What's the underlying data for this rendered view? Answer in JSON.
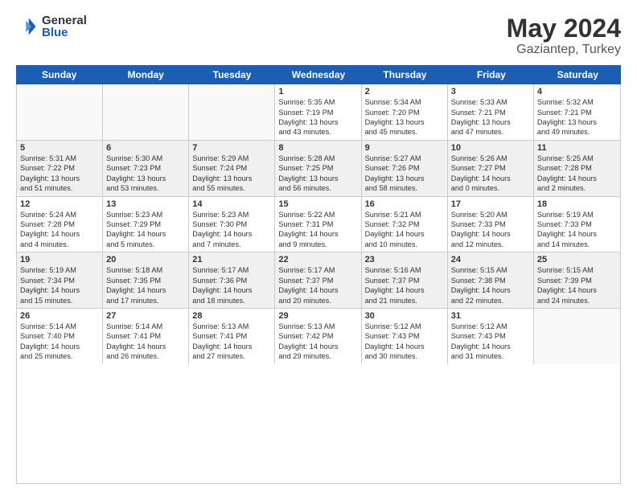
{
  "logo": {
    "general": "General",
    "blue": "Blue"
  },
  "title": "May 2024",
  "location": "Gaziantep, Turkey",
  "days": [
    "Sunday",
    "Monday",
    "Tuesday",
    "Wednesday",
    "Thursday",
    "Friday",
    "Saturday"
  ],
  "weeks": [
    [
      {
        "day": "",
        "info": ""
      },
      {
        "day": "",
        "info": ""
      },
      {
        "day": "",
        "info": ""
      },
      {
        "day": "1",
        "info": "Sunrise: 5:35 AM\nSunset: 7:19 PM\nDaylight: 13 hours\nand 43 minutes."
      },
      {
        "day": "2",
        "info": "Sunrise: 5:34 AM\nSunset: 7:20 PM\nDaylight: 13 hours\nand 45 minutes."
      },
      {
        "day": "3",
        "info": "Sunrise: 5:33 AM\nSunset: 7:21 PM\nDaylight: 13 hours\nand 47 minutes."
      },
      {
        "day": "4",
        "info": "Sunrise: 5:32 AM\nSunset: 7:21 PM\nDaylight: 13 hours\nand 49 minutes."
      }
    ],
    [
      {
        "day": "5",
        "info": "Sunrise: 5:31 AM\nSunset: 7:22 PM\nDaylight: 13 hours\nand 51 minutes."
      },
      {
        "day": "6",
        "info": "Sunrise: 5:30 AM\nSunset: 7:23 PM\nDaylight: 13 hours\nand 53 minutes."
      },
      {
        "day": "7",
        "info": "Sunrise: 5:29 AM\nSunset: 7:24 PM\nDaylight: 13 hours\nand 55 minutes."
      },
      {
        "day": "8",
        "info": "Sunrise: 5:28 AM\nSunset: 7:25 PM\nDaylight: 13 hours\nand 56 minutes."
      },
      {
        "day": "9",
        "info": "Sunrise: 5:27 AM\nSunset: 7:26 PM\nDaylight: 13 hours\nand 58 minutes."
      },
      {
        "day": "10",
        "info": "Sunrise: 5:26 AM\nSunset: 7:27 PM\nDaylight: 14 hours\nand 0 minutes."
      },
      {
        "day": "11",
        "info": "Sunrise: 5:25 AM\nSunset: 7:28 PM\nDaylight: 14 hours\nand 2 minutes."
      }
    ],
    [
      {
        "day": "12",
        "info": "Sunrise: 5:24 AM\nSunset: 7:28 PM\nDaylight: 14 hours\nand 4 minutes."
      },
      {
        "day": "13",
        "info": "Sunrise: 5:23 AM\nSunset: 7:29 PM\nDaylight: 14 hours\nand 5 minutes."
      },
      {
        "day": "14",
        "info": "Sunrise: 5:23 AM\nSunset: 7:30 PM\nDaylight: 14 hours\nand 7 minutes."
      },
      {
        "day": "15",
        "info": "Sunrise: 5:22 AM\nSunset: 7:31 PM\nDaylight: 14 hours\nand 9 minutes."
      },
      {
        "day": "16",
        "info": "Sunrise: 5:21 AM\nSunset: 7:32 PM\nDaylight: 14 hours\nand 10 minutes."
      },
      {
        "day": "17",
        "info": "Sunrise: 5:20 AM\nSunset: 7:33 PM\nDaylight: 14 hours\nand 12 minutes."
      },
      {
        "day": "18",
        "info": "Sunrise: 5:19 AM\nSunset: 7:33 PM\nDaylight: 14 hours\nand 14 minutes."
      }
    ],
    [
      {
        "day": "19",
        "info": "Sunrise: 5:19 AM\nSunset: 7:34 PM\nDaylight: 14 hours\nand 15 minutes."
      },
      {
        "day": "20",
        "info": "Sunrise: 5:18 AM\nSunset: 7:35 PM\nDaylight: 14 hours\nand 17 minutes."
      },
      {
        "day": "21",
        "info": "Sunrise: 5:17 AM\nSunset: 7:36 PM\nDaylight: 14 hours\nand 18 minutes."
      },
      {
        "day": "22",
        "info": "Sunrise: 5:17 AM\nSunset: 7:37 PM\nDaylight: 14 hours\nand 20 minutes."
      },
      {
        "day": "23",
        "info": "Sunrise: 5:16 AM\nSunset: 7:37 PM\nDaylight: 14 hours\nand 21 minutes."
      },
      {
        "day": "24",
        "info": "Sunrise: 5:15 AM\nSunset: 7:38 PM\nDaylight: 14 hours\nand 22 minutes."
      },
      {
        "day": "25",
        "info": "Sunrise: 5:15 AM\nSunset: 7:39 PM\nDaylight: 14 hours\nand 24 minutes."
      }
    ],
    [
      {
        "day": "26",
        "info": "Sunrise: 5:14 AM\nSunset: 7:40 PM\nDaylight: 14 hours\nand 25 minutes."
      },
      {
        "day": "27",
        "info": "Sunrise: 5:14 AM\nSunset: 7:41 PM\nDaylight: 14 hours\nand 26 minutes."
      },
      {
        "day": "28",
        "info": "Sunrise: 5:13 AM\nSunset: 7:41 PM\nDaylight: 14 hours\nand 27 minutes."
      },
      {
        "day": "29",
        "info": "Sunrise: 5:13 AM\nSunset: 7:42 PM\nDaylight: 14 hours\nand 29 minutes."
      },
      {
        "day": "30",
        "info": "Sunrise: 5:12 AM\nSunset: 7:43 PM\nDaylight: 14 hours\nand 30 minutes."
      },
      {
        "day": "31",
        "info": "Sunrise: 5:12 AM\nSunset: 7:43 PM\nDaylight: 14 hours\nand 31 minutes."
      },
      {
        "day": "",
        "info": ""
      }
    ]
  ]
}
